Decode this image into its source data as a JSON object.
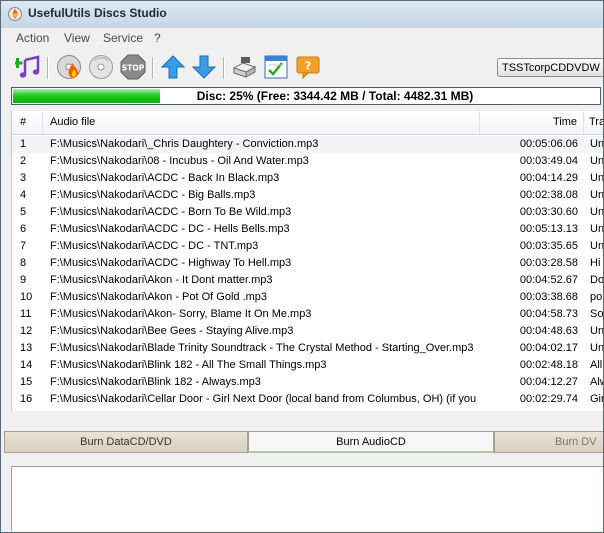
{
  "window": {
    "title": "UsefulUtils Discs Studio"
  },
  "menu": [
    "Action",
    "View",
    "Service",
    "?"
  ],
  "toolbar": {
    "icons": [
      "add-music-icon",
      "burn-icon",
      "erase-disc-icon",
      "stop-icon",
      "move-up-icon",
      "move-down-icon",
      "drive-icon",
      "checklist-icon",
      "help-icon"
    ],
    "drive_select": "TSSTcorpCDDVDW"
  },
  "disc_status": {
    "text": "Disc: 25% (Free: 3344.42 MB / Total: 4482.31 MB)",
    "used_fraction": 0.25,
    "bar_color": "#22cc22"
  },
  "tracklist": {
    "columns": [
      "#",
      "Audio file",
      "Time",
      "Tra"
    ],
    "rows": [
      {
        "n": "1",
        "file": "F:\\Musics\\Nakodari\\_Chris Daughtery - Conviction.mp3",
        "time": "00:05:06.06",
        "extra": "Un"
      },
      {
        "n": "2",
        "file": "F:\\Musics\\Nakodari\\08 - Incubus - Oil And Water.mp3",
        "time": "00:03:49.04",
        "extra": "Un"
      },
      {
        "n": "3",
        "file": "F:\\Musics\\Nakodari\\ACDC - Back In Black.mp3",
        "time": "00:04:14.29",
        "extra": "Un"
      },
      {
        "n": "4",
        "file": "F:\\Musics\\Nakodari\\ACDC - Big Balls.mp3",
        "time": "00:02:38.08",
        "extra": "Un"
      },
      {
        "n": "5",
        "file": "F:\\Musics\\Nakodari\\ACDC - Born To Be Wild.mp3",
        "time": "00:03:30.60",
        "extra": "Un"
      },
      {
        "n": "6",
        "file": "F:\\Musics\\Nakodari\\ACDC - DC - Hells Bells.mp3",
        "time": "00:05:13.13",
        "extra": "Un"
      },
      {
        "n": "7",
        "file": "F:\\Musics\\Nakodari\\ACDC - DC - TNT.mp3",
        "time": "00:03:35.65",
        "extra": "Un"
      },
      {
        "n": "8",
        "file": "F:\\Musics\\Nakodari\\ACDC - Highway To Hell.mp3",
        "time": "00:03:28.58",
        "extra": "Hi"
      },
      {
        "n": "9",
        "file": "F:\\Musics\\Nakodari\\Akon - It  Dont matter.mp3",
        "time": "00:04:52.67",
        "extra": "Do"
      },
      {
        "n": "10",
        "file": "F:\\Musics\\Nakodari\\Akon - Pot Of Gold .mp3",
        "time": "00:03:38.68",
        "extra": "po"
      },
      {
        "n": "11",
        "file": "F:\\Musics\\Nakodari\\Akon- Sorry, Blame It On Me.mp3",
        "time": "00:04:58.73",
        "extra": "So"
      },
      {
        "n": "12",
        "file": "F:\\Musics\\Nakodari\\Bee Gees - Staying Alive.mp3",
        "time": "00:04:48.63",
        "extra": "Un"
      },
      {
        "n": "13",
        "file": "F:\\Musics\\Nakodari\\Blade Trinity Soundtrack - The Crystal Method - Starting_Over.mp3",
        "time": "00:04:02.17",
        "extra": "Un"
      },
      {
        "n": "14",
        "file": "F:\\Musics\\Nakodari\\Blink 182 - All The Small Things.mp3",
        "time": "00:02:48.18",
        "extra": "All"
      },
      {
        "n": "15",
        "file": "F:\\Musics\\Nakodari\\Blink 182 - Always.mp3",
        "time": "00:04:12.27",
        "extra": "Alw"
      },
      {
        "n": "16",
        "file": "F:\\Musics\\Nakodari\\Cellar Door - Girl Next Door (local band from Columbus, OH) (if you ...",
        "time": "00:02:29.74",
        "extra": "Gir"
      }
    ]
  },
  "tabs": [
    {
      "label": "Burn DataCD/DVD",
      "active": false
    },
    {
      "label": "Burn AudioCD",
      "active": true
    },
    {
      "label": "Burn DV",
      "active": false
    }
  ]
}
